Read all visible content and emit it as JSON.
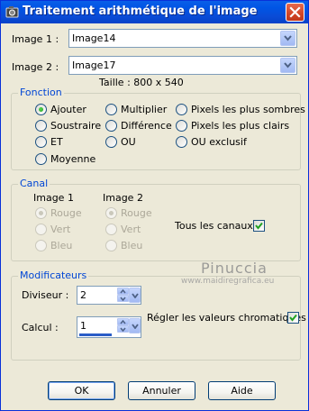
{
  "window": {
    "title": "Traitement arithmétique de l'image"
  },
  "image1": {
    "label": "Image 1 :",
    "value": "Image14"
  },
  "image2": {
    "label": "Image 2 :",
    "value": "Image17"
  },
  "size_info": "Taille : 800 x 540",
  "fonction": {
    "legend": "Fonction",
    "options": [
      "Ajouter",
      "Multiplier",
      "Pixels les plus sombres",
      "Soustraire",
      "Différence",
      "Pixels les plus clairs",
      "ET",
      "OU",
      "OU exclusif",
      "Moyenne"
    ],
    "selected": "Ajouter"
  },
  "canal": {
    "legend": "Canal",
    "image1_header": "Image 1",
    "image2_header": "Image 2",
    "image1_options": [
      "Rouge",
      "Vert",
      "Bleu"
    ],
    "image2_options": [
      "Rouge",
      "Vert",
      "Bleu"
    ],
    "selected": "Rouge",
    "all_channels_label": "Tous les canaux",
    "all_channels_checked": true
  },
  "modificateurs": {
    "legend": "Modificateurs",
    "divisor_label": "Diviseur :",
    "divisor_value": "2",
    "calc_label": "Calcul :",
    "calc_value": "1",
    "chromatic_label": "Régler les valeurs chromatiques",
    "chromatic_checked": true
  },
  "buttons": {
    "ok": "OK",
    "cancel": "Annuler",
    "help": "Aide"
  },
  "watermark": {
    "name": "Pinuccia",
    "url": "www.maidiregrafica.eu"
  },
  "colors": {
    "titlebar": "#0A4BD6",
    "face": "#ECE9D8",
    "group_legend": "#0046D5"
  }
}
